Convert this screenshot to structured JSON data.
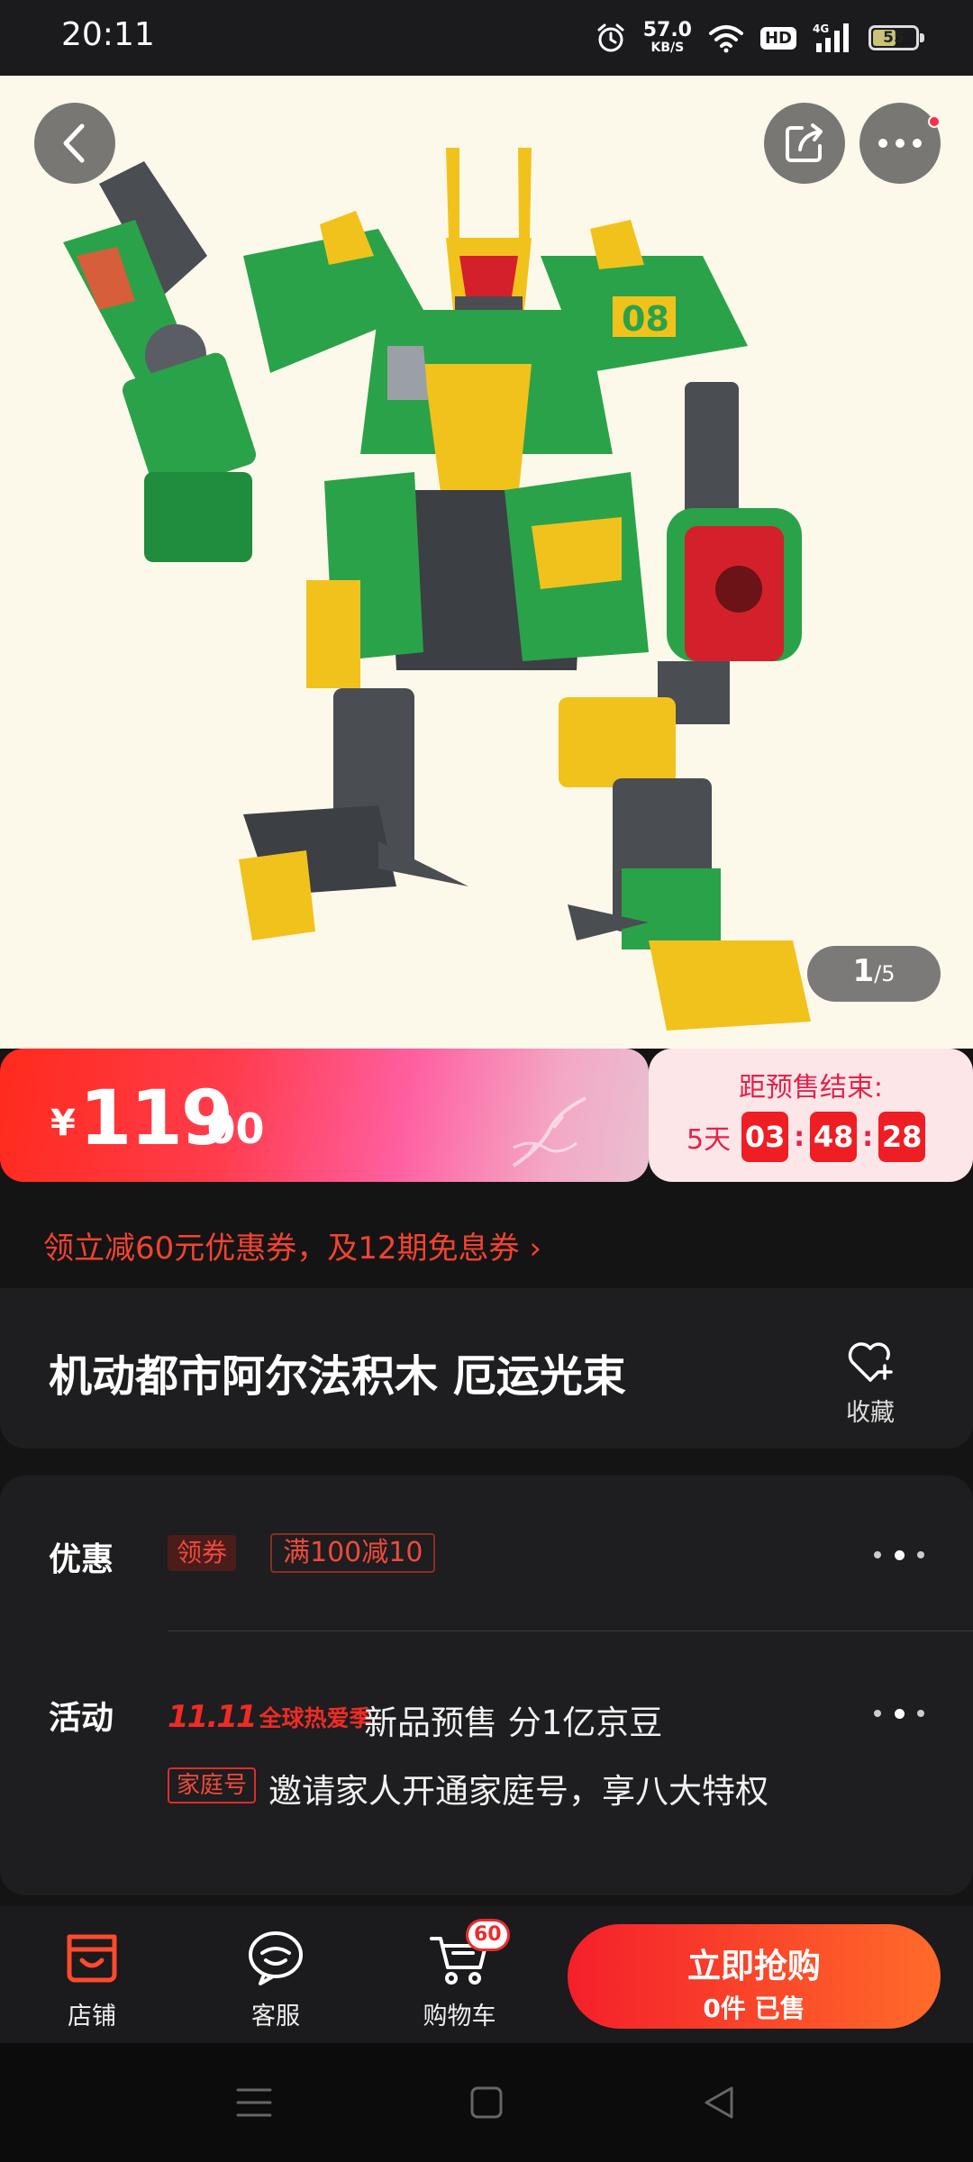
{
  "status_bar": {
    "time": "20:11",
    "net_speed_value": "57.0",
    "net_speed_unit": "KB/S",
    "hd_label": "HD",
    "signal_label": "4G",
    "battery": "55",
    "battery_level": 0.55,
    "icons": [
      "alarm-icon",
      "wifi-icon",
      "signal-icon",
      "battery-icon"
    ]
  },
  "hero": {
    "image_current": "1",
    "image_separator": "/",
    "image_total": "5",
    "colors": {
      "robot_green": "#2aa24a",
      "robot_yellow": "#f2c21c",
      "robot_red": "#d4202a",
      "robot_grey": "#4a4d52"
    }
  },
  "price": {
    "currency": "¥",
    "integer": "119",
    "decimal": ".00"
  },
  "presale": {
    "title": "距预售结束:",
    "days": "5天",
    "hours": "03",
    "minutes": "48",
    "seconds": "28",
    "colon": ":"
  },
  "coupon_line": "领立减60元优惠券，及12期免息券 ›",
  "product": {
    "title": "机动都市阿尔法积木 厄运光束",
    "favorite_label": "收藏"
  },
  "promotions": {
    "discount_label": "优惠",
    "coupon_tag": "领券",
    "discount_rule": "满100减10",
    "activity_label": "活动",
    "event_logo_main": "11.11",
    "event_logo_sub": "全球热爱季",
    "event_text": "新品预售 分1亿京豆",
    "family_tag": "家庭号",
    "family_text": "邀请家人开通家庭号，享八大特权"
  },
  "action_bar": {
    "store_label": "店铺",
    "service_label": "客服",
    "cart_label": "购物车",
    "cart_count": "60",
    "buy_label": "立即抢购",
    "sold_label": "0件 已售"
  },
  "colors": {
    "accent_red": "#ee1e24",
    "page_bg": "#141414",
    "card_bg": "#1e1d1f"
  }
}
